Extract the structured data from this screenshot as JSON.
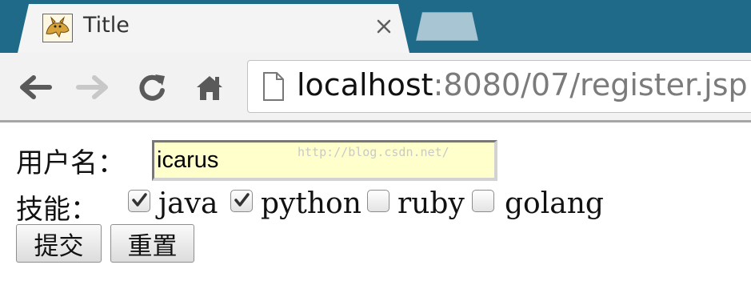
{
  "browser": {
    "tab_title": "Title",
    "url_host": "localhost",
    "url_path": ":8080/07/register.jsp"
  },
  "icons": {
    "favicon": "tomcat-icon",
    "tab_close": "close-icon",
    "back": "back-arrow-icon",
    "forward": "forward-arrow-icon",
    "reload": "reload-icon",
    "home": "home-icon",
    "page": "page-icon"
  },
  "form": {
    "username_label": "用户名：",
    "username_value": "icarus",
    "skills_label": "技能：",
    "skills": [
      {
        "label": "java",
        "checked": true
      },
      {
        "label": "python",
        "checked": true
      },
      {
        "label": "ruby",
        "checked": false
      },
      {
        "label": "golang",
        "checked": false
      }
    ],
    "submit_label": "提交",
    "reset_label": "重置"
  },
  "watermark": "http://blog.csdn.net/",
  "colors": {
    "tabbar": "#1e6a88",
    "input_bg": "#ffffcc"
  }
}
